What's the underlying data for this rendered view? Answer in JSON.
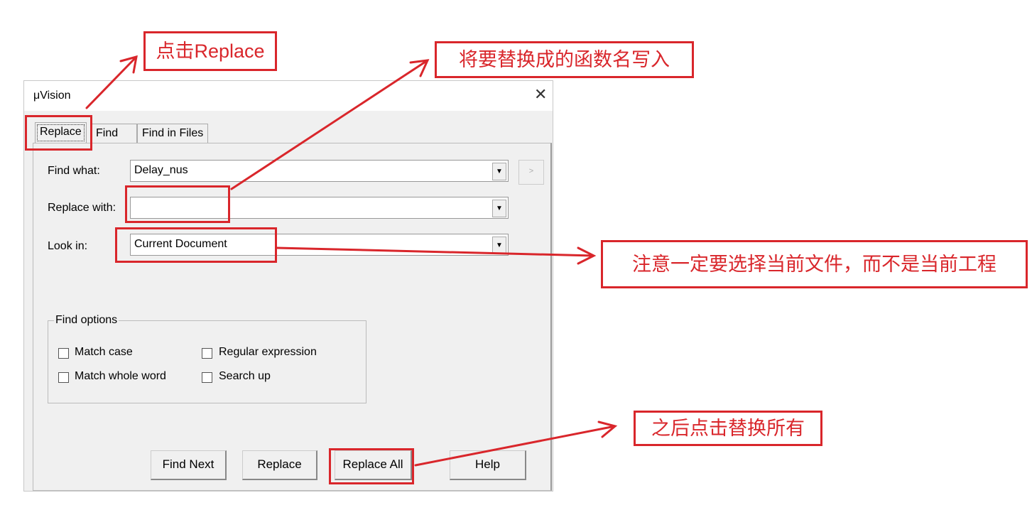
{
  "dialog": {
    "title": "μVision",
    "close_icon": "close-icon",
    "tabs": [
      {
        "label": "Replace",
        "active": true
      },
      {
        "label": "Find"
      },
      {
        "label": "Find in Files"
      }
    ],
    "find_what": {
      "label": "Find what:",
      "value": "Delay_nus"
    },
    "replace_with": {
      "label": "Replace with:",
      "value": ""
    },
    "look_in": {
      "label": "Look in:",
      "value": "Current Document"
    },
    "more_button": ">",
    "find_options": {
      "legend": "Find options",
      "options": [
        {
          "label": "Match case",
          "checked": false
        },
        {
          "label": "Regular expression",
          "checked": false
        },
        {
          "label": "Match whole word",
          "checked": false
        },
        {
          "label": "Search up",
          "checked": false
        }
      ]
    },
    "buttons": [
      "Find Next",
      "Replace",
      "Replace All",
      "Help"
    ]
  },
  "annotations": {
    "color": "#d9262b",
    "click_replace": "点击Replace",
    "write_name": "将要替换成的函数名写入",
    "choose_document": "注意一定要选择当前文件，而不是当前工程",
    "replace_all": "之后点击替换所有"
  }
}
